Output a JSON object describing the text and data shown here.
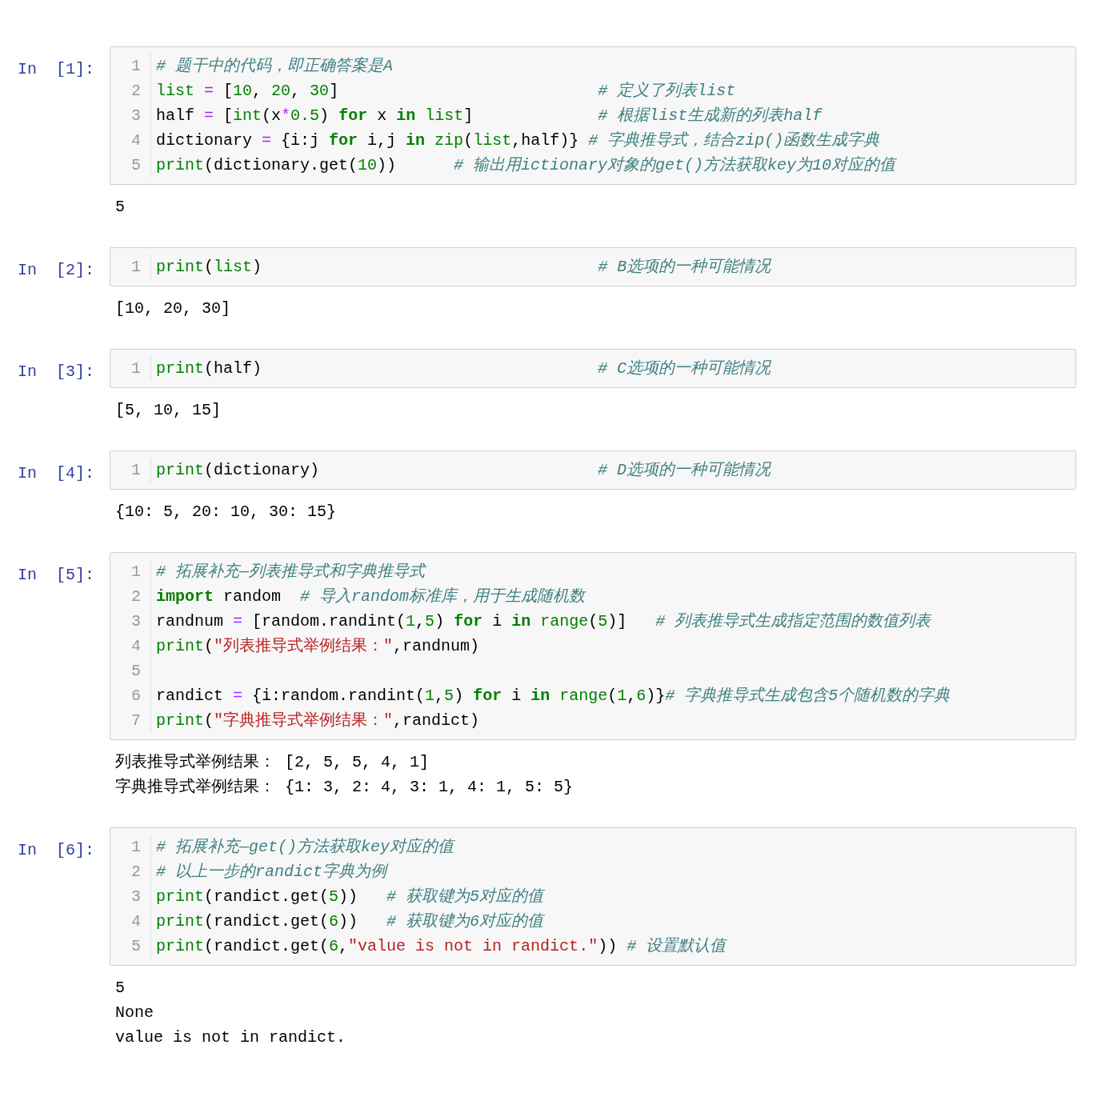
{
  "cells": [
    {
      "prompt": "In  [1]:",
      "lines": [
        {
          "number": "1",
          "tokens": [
            {
              "kind": "comment",
              "text": "# 题干中的代码，即正确答案是A"
            }
          ]
        },
        {
          "number": "2",
          "tokens": [
            {
              "kind": "builtin",
              "text": "list "
            },
            {
              "kind": "operator",
              "text": "="
            },
            {
              "kind": "plain",
              "text": " ["
            },
            {
              "kind": "number",
              "text": "10"
            },
            {
              "kind": "plain",
              "text": ", "
            },
            {
              "kind": "number",
              "text": "20"
            },
            {
              "kind": "plain",
              "text": ", "
            },
            {
              "kind": "number",
              "text": "30"
            },
            {
              "kind": "plain",
              "text": "]                           "
            },
            {
              "kind": "comment",
              "text": "# 定义了列表list"
            }
          ]
        },
        {
          "number": "3",
          "tokens": [
            {
              "kind": "plain",
              "text": "half "
            },
            {
              "kind": "operator",
              "text": "="
            },
            {
              "kind": "plain",
              "text": " ["
            },
            {
              "kind": "builtin",
              "text": "int"
            },
            {
              "kind": "plain",
              "text": "(x"
            },
            {
              "kind": "operator",
              "text": "*"
            },
            {
              "kind": "number",
              "text": "0.5"
            },
            {
              "kind": "plain",
              "text": ") "
            },
            {
              "kind": "keyword",
              "text": "for"
            },
            {
              "kind": "plain",
              "text": " x "
            },
            {
              "kind": "keyword",
              "text": "in"
            },
            {
              "kind": "builtin",
              "text": " list"
            },
            {
              "kind": "plain",
              "text": "]             "
            },
            {
              "kind": "comment",
              "text": "# 根据list生成新的列表half"
            }
          ]
        },
        {
          "number": "4",
          "tokens": [
            {
              "kind": "plain",
              "text": "dictionary "
            },
            {
              "kind": "operator",
              "text": "="
            },
            {
              "kind": "plain",
              "text": " {i:j "
            },
            {
              "kind": "keyword",
              "text": "for"
            },
            {
              "kind": "plain",
              "text": " i,j "
            },
            {
              "kind": "keyword",
              "text": "in"
            },
            {
              "kind": "builtin",
              "text": " zip"
            },
            {
              "kind": "plain",
              "text": "("
            },
            {
              "kind": "builtin",
              "text": "list"
            },
            {
              "kind": "plain",
              "text": ",half)} "
            },
            {
              "kind": "comment",
              "text": "# 字典推导式，结合zip()函数生成字典"
            }
          ]
        },
        {
          "number": "5",
          "tokens": [
            {
              "kind": "builtin",
              "text": "print"
            },
            {
              "kind": "plain",
              "text": "(dictionary.get("
            },
            {
              "kind": "number",
              "text": "10"
            },
            {
              "kind": "plain",
              "text": "))      "
            },
            {
              "kind": "comment",
              "text": "# 输出用ictionary对象的get()方法获取key为10对应的值"
            }
          ]
        }
      ],
      "output": [
        "5"
      ]
    },
    {
      "prompt": "In  [2]:",
      "lines": [
        {
          "number": "1",
          "tokens": [
            {
              "kind": "builtin",
              "text": "print"
            },
            {
              "kind": "plain",
              "text": "("
            },
            {
              "kind": "builtin",
              "text": "list"
            },
            {
              "kind": "plain",
              "text": ")                                   "
            },
            {
              "kind": "comment",
              "text": "# B选项的一种可能情况"
            }
          ]
        }
      ],
      "output": [
        "[10, 20, 30]"
      ]
    },
    {
      "prompt": "In  [3]:",
      "lines": [
        {
          "number": "1",
          "tokens": [
            {
              "kind": "builtin",
              "text": "print"
            },
            {
              "kind": "plain",
              "text": "(half)                                   "
            },
            {
              "kind": "comment",
              "text": "# C选项的一种可能情况"
            }
          ]
        }
      ],
      "output": [
        "[5, 10, 15]"
      ]
    },
    {
      "prompt": "In  [4]:",
      "lines": [
        {
          "number": "1",
          "tokens": [
            {
              "kind": "builtin",
              "text": "print"
            },
            {
              "kind": "plain",
              "text": "(dictionary)                             "
            },
            {
              "kind": "comment",
              "text": "# D选项的一种可能情况"
            }
          ]
        }
      ],
      "output": [
        "{10: 5, 20: 10, 30: 15}"
      ]
    },
    {
      "prompt": "In  [5]:",
      "lines": [
        {
          "number": "1",
          "tokens": [
            {
              "kind": "comment",
              "text": "# 拓展补充—列表推导式和字典推导式"
            }
          ]
        },
        {
          "number": "2",
          "tokens": [
            {
              "kind": "keyword",
              "text": "import"
            },
            {
              "kind": "plain",
              "text": " random  "
            },
            {
              "kind": "comment",
              "text": "# 导入random标准库，用于生成随机数"
            }
          ]
        },
        {
          "number": "3",
          "tokens": [
            {
              "kind": "plain",
              "text": "randnum "
            },
            {
              "kind": "operator",
              "text": "="
            },
            {
              "kind": "plain",
              "text": " [random.randint("
            },
            {
              "kind": "number",
              "text": "1"
            },
            {
              "kind": "plain",
              "text": ","
            },
            {
              "kind": "number",
              "text": "5"
            },
            {
              "kind": "plain",
              "text": ") "
            },
            {
              "kind": "keyword",
              "text": "for"
            },
            {
              "kind": "plain",
              "text": " i "
            },
            {
              "kind": "keyword",
              "text": "in"
            },
            {
              "kind": "builtin",
              "text": " range"
            },
            {
              "kind": "plain",
              "text": "("
            },
            {
              "kind": "number",
              "text": "5"
            },
            {
              "kind": "plain",
              "text": ")]   "
            },
            {
              "kind": "comment",
              "text": "# 列表推导式生成指定范围的数值列表"
            }
          ]
        },
        {
          "number": "4",
          "tokens": [
            {
              "kind": "builtin",
              "text": "print"
            },
            {
              "kind": "plain",
              "text": "("
            },
            {
              "kind": "string",
              "text": "\"列表推导式举例结果：\""
            },
            {
              "kind": "plain",
              "text": ",randnum)"
            }
          ]
        },
        {
          "number": "5"
        },
        {
          "number": "6",
          "tokens": [
            {
              "kind": "plain",
              "text": "randict "
            },
            {
              "kind": "operator",
              "text": "="
            },
            {
              "kind": "plain",
              "text": " {i:random.randint("
            },
            {
              "kind": "number",
              "text": "1"
            },
            {
              "kind": "plain",
              "text": ","
            },
            {
              "kind": "number",
              "text": "5"
            },
            {
              "kind": "plain",
              "text": ") "
            },
            {
              "kind": "keyword",
              "text": "for"
            },
            {
              "kind": "plain",
              "text": " i "
            },
            {
              "kind": "keyword",
              "text": "in"
            },
            {
              "kind": "builtin",
              "text": " range"
            },
            {
              "kind": "plain",
              "text": "("
            },
            {
              "kind": "number",
              "text": "1"
            },
            {
              "kind": "plain",
              "text": ","
            },
            {
              "kind": "number",
              "text": "6"
            },
            {
              "kind": "plain",
              "text": ")}"
            },
            {
              "kind": "comment",
              "text": "# 字典推导式生成包含5个随机数的字典"
            }
          ]
        },
        {
          "number": "7",
          "tokens": [
            {
              "kind": "builtin",
              "text": "print"
            },
            {
              "kind": "plain",
              "text": "("
            },
            {
              "kind": "string",
              "text": "\"字典推导式举例结果：\""
            },
            {
              "kind": "plain",
              "text": ",randict)"
            }
          ]
        }
      ],
      "output": [
        "列表推导式举例结果： [2, 5, 5, 4, 1]",
        "字典推导式举例结果： {1: 3, 2: 4, 3: 1, 4: 1, 5: 5}"
      ]
    },
    {
      "prompt": "In  [6]:",
      "lines": [
        {
          "number": "1",
          "tokens": [
            {
              "kind": "comment",
              "text": "# 拓展补充—get()方法获取key对应的值"
            }
          ]
        },
        {
          "number": "2",
          "tokens": [
            {
              "kind": "comment",
              "text": "# 以上一步的randict字典为例"
            }
          ]
        },
        {
          "number": "3",
          "tokens": [
            {
              "kind": "builtin",
              "text": "print"
            },
            {
              "kind": "plain",
              "text": "(randict.get("
            },
            {
              "kind": "number",
              "text": "5"
            },
            {
              "kind": "plain",
              "text": "))   "
            },
            {
              "kind": "comment",
              "text": "# 获取键为5对应的值"
            }
          ]
        },
        {
          "number": "4",
          "tokens": [
            {
              "kind": "builtin",
              "text": "print"
            },
            {
              "kind": "plain",
              "text": "(randict.get("
            },
            {
              "kind": "number",
              "text": "6"
            },
            {
              "kind": "plain",
              "text": "))   "
            },
            {
              "kind": "comment",
              "text": "# 获取键为6对应的值"
            }
          ]
        },
        {
          "number": "5",
          "tokens": [
            {
              "kind": "builtin",
              "text": "print"
            },
            {
              "kind": "plain",
              "text": "(randict.get("
            },
            {
              "kind": "number",
              "text": "6"
            },
            {
              "kind": "plain",
              "text": ","
            },
            {
              "kind": "string",
              "text": "\"value is not in randict.\""
            },
            {
              "kind": "plain",
              "text": ")) "
            },
            {
              "kind": "comment",
              "text": "# 设置默认值"
            }
          ]
        }
      ],
      "output": [
        "5",
        "None",
        "value is not in randict."
      ]
    }
  ]
}
